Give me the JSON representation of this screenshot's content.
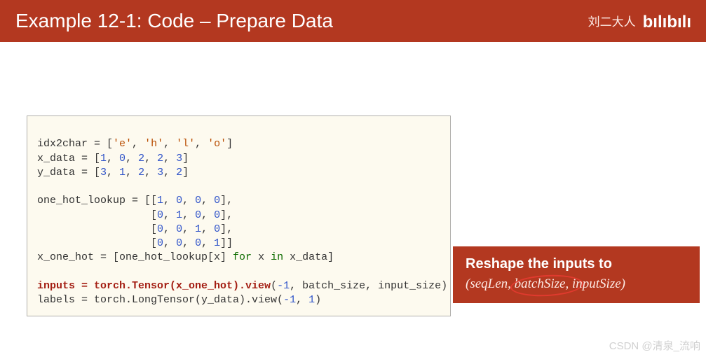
{
  "titlebar": {
    "title": "Example 12-1: Code – Prepare Data",
    "author": "刘二大人",
    "logo": "bilibili"
  },
  "code": {
    "l1_a": "idx2char = [",
    "l1_e": "'e'",
    "l1_h": "'h'",
    "l1_l": "'l'",
    "l1_o": "'o'",
    "l1_z": "]",
    "l2_a": "x_data = [",
    "l2_v": [
      "1",
      "0",
      "2",
      "2",
      "3"
    ],
    "l2_z": "]",
    "l3_a": "y_data = [",
    "l3_v": [
      "3",
      "1",
      "2",
      "3",
      "2"
    ],
    "l3_z": "]",
    "l5_a": "one_hot_lookup = [[",
    "l5_v": [
      "1",
      "0",
      "0",
      "0"
    ],
    "l5_z": "],",
    "pad": "                  [",
    "l6_v": [
      "0",
      "1",
      "0",
      "0"
    ],
    "l6_z": "],",
    "l7_v": [
      "0",
      "0",
      "1",
      "0"
    ],
    "l7_z": "],",
    "l8_v": [
      "0",
      "0",
      "0",
      "1"
    ],
    "l8_z": "]]",
    "l9_a": "x_one_hot = [one_hot_lookup[x] ",
    "l9_for": "for",
    "l9_b": " x ",
    "l9_in": "in",
    "l9_c": " x_data]",
    "l11_a": "inputs = torch.Tensor(x_one_hot).view",
    "l11_b": "(",
    "l11_n1": "-1",
    "l11_c": ", batch_size, input_size)",
    "l12_a": "labels = torch.LongTensor(y_data).view(",
    "l12_n1": "-1",
    "l12_b": ", ",
    "l12_n2": "1",
    "l12_c": ")"
  },
  "sidebox": {
    "heading": "Reshape the inputs to",
    "lp": "(",
    "t1": "seqLen",
    "c1": ",",
    "t2": "batchSize",
    "c2": ",",
    "t3": "inputSize",
    "rp": ")"
  },
  "watermark": "CSDN @清泉_流响"
}
